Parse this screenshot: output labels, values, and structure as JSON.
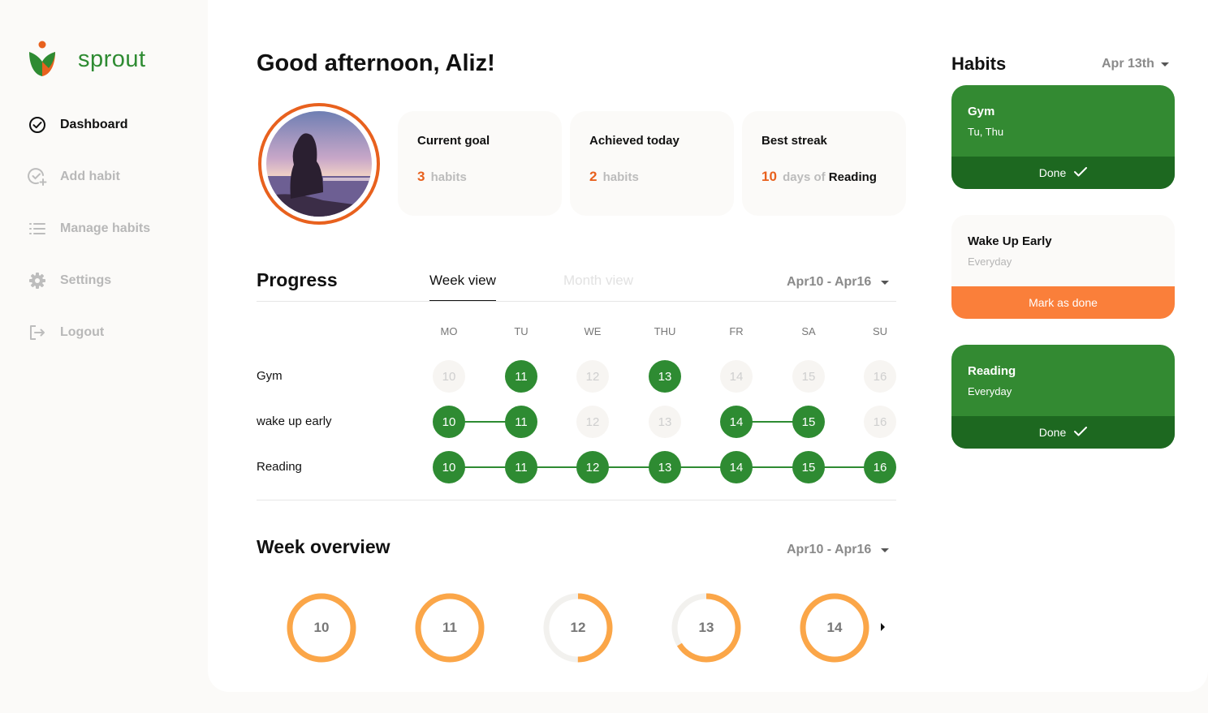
{
  "brand": {
    "name": "sprout"
  },
  "nav": [
    {
      "label": "Dashboard",
      "icon": "check-circle-icon",
      "active": true
    },
    {
      "label": "Add habit",
      "icon": "add-habit-icon",
      "active": false
    },
    {
      "label": "Manage habits",
      "icon": "list-icon",
      "active": false
    },
    {
      "label": "Settings",
      "icon": "gear-icon",
      "active": false
    },
    {
      "label": "Logout",
      "icon": "logout-icon",
      "active": false
    }
  ],
  "greeting": "Good afternoon, Aliz!",
  "stats": {
    "current_goal": {
      "title": "Current goal",
      "value": "3",
      "unit": "habits"
    },
    "achieved_today": {
      "title": "Achieved today",
      "value": "2",
      "unit": "habits"
    },
    "best_streak": {
      "title": "Best streak",
      "value": "10",
      "unit": "days of",
      "habit": "Reading"
    }
  },
  "progress": {
    "title": "Progress",
    "tabs": [
      "Week view",
      "Month view"
    ],
    "active_tab": "Week view",
    "range": "Apr10 - Apr16",
    "days": [
      "MO",
      "TU",
      "WE",
      "THU",
      "FR",
      "SA",
      "SU"
    ],
    "dates": [
      "10",
      "11",
      "12",
      "13",
      "14",
      "15",
      "16"
    ],
    "rows": [
      {
        "name": "Gym",
        "done": [
          false,
          true,
          false,
          true,
          false,
          false,
          false
        ]
      },
      {
        "name": "wake up early",
        "done": [
          true,
          true,
          false,
          false,
          true,
          true,
          false
        ]
      },
      {
        "name": "Reading",
        "done": [
          true,
          true,
          true,
          true,
          true,
          true,
          true
        ]
      }
    ]
  },
  "overview": {
    "title": "Week overview",
    "range": "Apr10 - Apr16",
    "days": [
      {
        "date": "10",
        "completion": 1.0
      },
      {
        "date": "11",
        "completion": 1.0
      },
      {
        "date": "12",
        "completion": 0.5
      },
      {
        "date": "13",
        "completion": 0.66
      },
      {
        "date": "14",
        "completion": 1.0
      }
    ]
  },
  "habits_panel": {
    "title": "Habits",
    "date": "Apr 13th",
    "cards": [
      {
        "name": "Gym",
        "schedule": "Tu, Thu",
        "status": "done",
        "button": "Done"
      },
      {
        "name": "Wake Up Early",
        "schedule": "Everyday",
        "status": "pending",
        "button": "Mark as done"
      },
      {
        "name": "Reading",
        "schedule": "Everyday",
        "status": "done",
        "button": "Done"
      }
    ]
  },
  "colors": {
    "brand_green": "#2e8b32",
    "dark_green": "#1d6820",
    "accent_orange": "#e8611e",
    "button_orange": "#fa7f3a",
    "ring_orange": "#fba648",
    "ring_track": "#f2f1ee"
  }
}
